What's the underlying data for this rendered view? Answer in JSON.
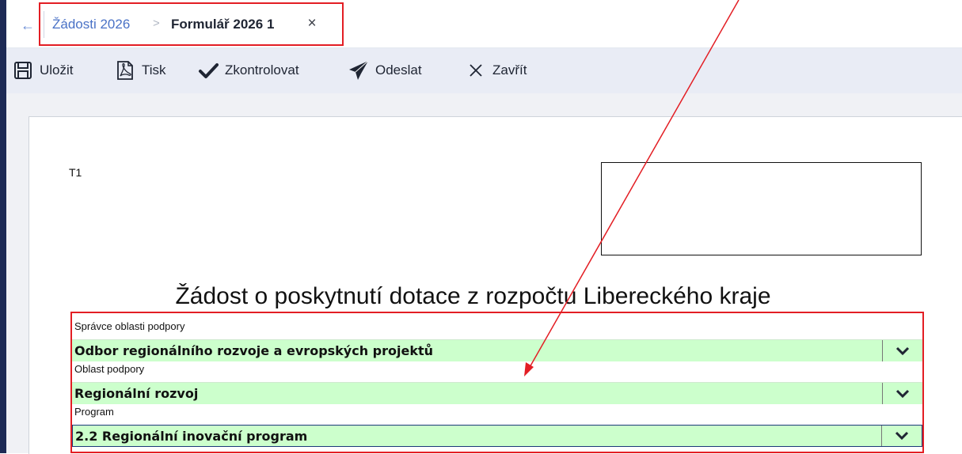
{
  "breadcrumb": {
    "back_icon": "arrow-left-icon",
    "items": [
      "Žádosti 2026",
      "Formulář 2026 1"
    ],
    "separator": ">",
    "close_icon": "close-icon"
  },
  "toolbar": {
    "buttons": [
      {
        "label": "Uložit",
        "icon": "save-icon"
      },
      {
        "label": "Tisk",
        "icon": "pdf-icon"
      },
      {
        "label": "Zkontrolovat",
        "icon": "check-icon"
      },
      {
        "label": "Odeslat",
        "icon": "send-icon"
      },
      {
        "label": "Zavřít",
        "icon": "close-icon"
      }
    ]
  },
  "document": {
    "code": "T1",
    "title": "Žádost o poskytnutí dotace z rozpočtu Libereckého kraje",
    "fields": [
      {
        "label": "Správce oblasti podpory",
        "value": "Odbor regionálního rozvoje a evropských projektů"
      },
      {
        "label": "Oblast podpory",
        "value": "Regionální rozvoj"
      },
      {
        "label": "Program",
        "value": "2.2 Regionální inovační program"
      }
    ]
  },
  "colors": {
    "accent": "#4a72c6",
    "field_fill": "#ccffcc",
    "highlight_red": "#e31e24",
    "sidebar": "#1d2a55"
  }
}
